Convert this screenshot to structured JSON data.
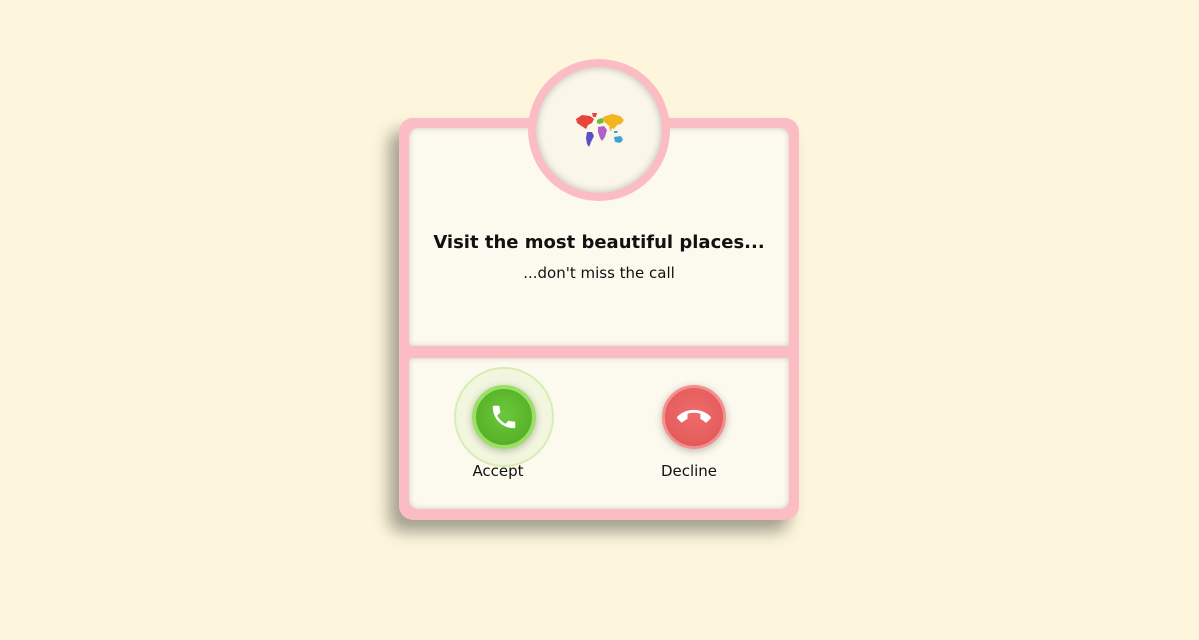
{
  "card": {
    "title": "Visit the most beautiful places...",
    "subtitle": "...don't miss the call"
  },
  "avatar": {
    "icon": "world-map-icon"
  },
  "actions": {
    "accept_label": "Accept",
    "decline_label": "Decline",
    "accept_icon": "phone-icon",
    "decline_icon": "phone-hangup-icon"
  },
  "colors": {
    "background": "#fdf6dc",
    "card_border": "#fbbcc3",
    "card_fill": "#fcf9ee",
    "accept": "#5bb52c",
    "decline": "#e75f5f"
  }
}
